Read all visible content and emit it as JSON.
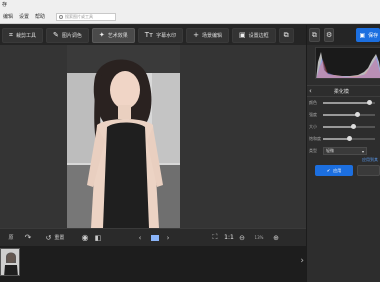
{
  "window": {
    "title": "存"
  },
  "menu": {
    "items": [
      "编辑",
      "设置",
      "帮助"
    ],
    "search_placeholder": "搜索图片或工具"
  },
  "toolbar": {
    "items": [
      {
        "label": "裁剪工具",
        "icon": "crop-icon",
        "glyph": "⌗",
        "active": false
      },
      {
        "label": "图片调色",
        "icon": "brush-icon",
        "glyph": "✎",
        "active": false
      },
      {
        "label": "艺术效果",
        "icon": "art-icon",
        "glyph": "✦",
        "active": true
      },
      {
        "label": "字幕水印",
        "icon": "text-icon",
        "glyph": "Tт",
        "active": false
      },
      {
        "label": "场景编辑",
        "icon": "plus-icon",
        "glyph": "+",
        "active": false
      },
      {
        "label": "设置边框",
        "icon": "frame-icon",
        "glyph": "▣",
        "active": false
      }
    ]
  },
  "controls": {
    "undo_label": "原",
    "reset_label": "重置",
    "ratio_label": "1:1",
    "zoom_value": "13%"
  },
  "panel": {
    "save_label": "保存",
    "section_title": "柔化模",
    "sliders": [
      {
        "label": "颜色",
        "value": 0.88
      },
      {
        "label": "强度",
        "value": 0.66
      },
      {
        "label": "大小",
        "value": 0.58
      },
      {
        "label": "饱和度",
        "value": 0.5
      }
    ],
    "type_label": "类型",
    "type_value": "轻微",
    "link_label": "应用到其",
    "apply_label": "应用"
  },
  "colors": {
    "accent": "#1c6fe0",
    "dark_bg": "#2b2b2b",
    "canvas_bg": "#343434"
  }
}
